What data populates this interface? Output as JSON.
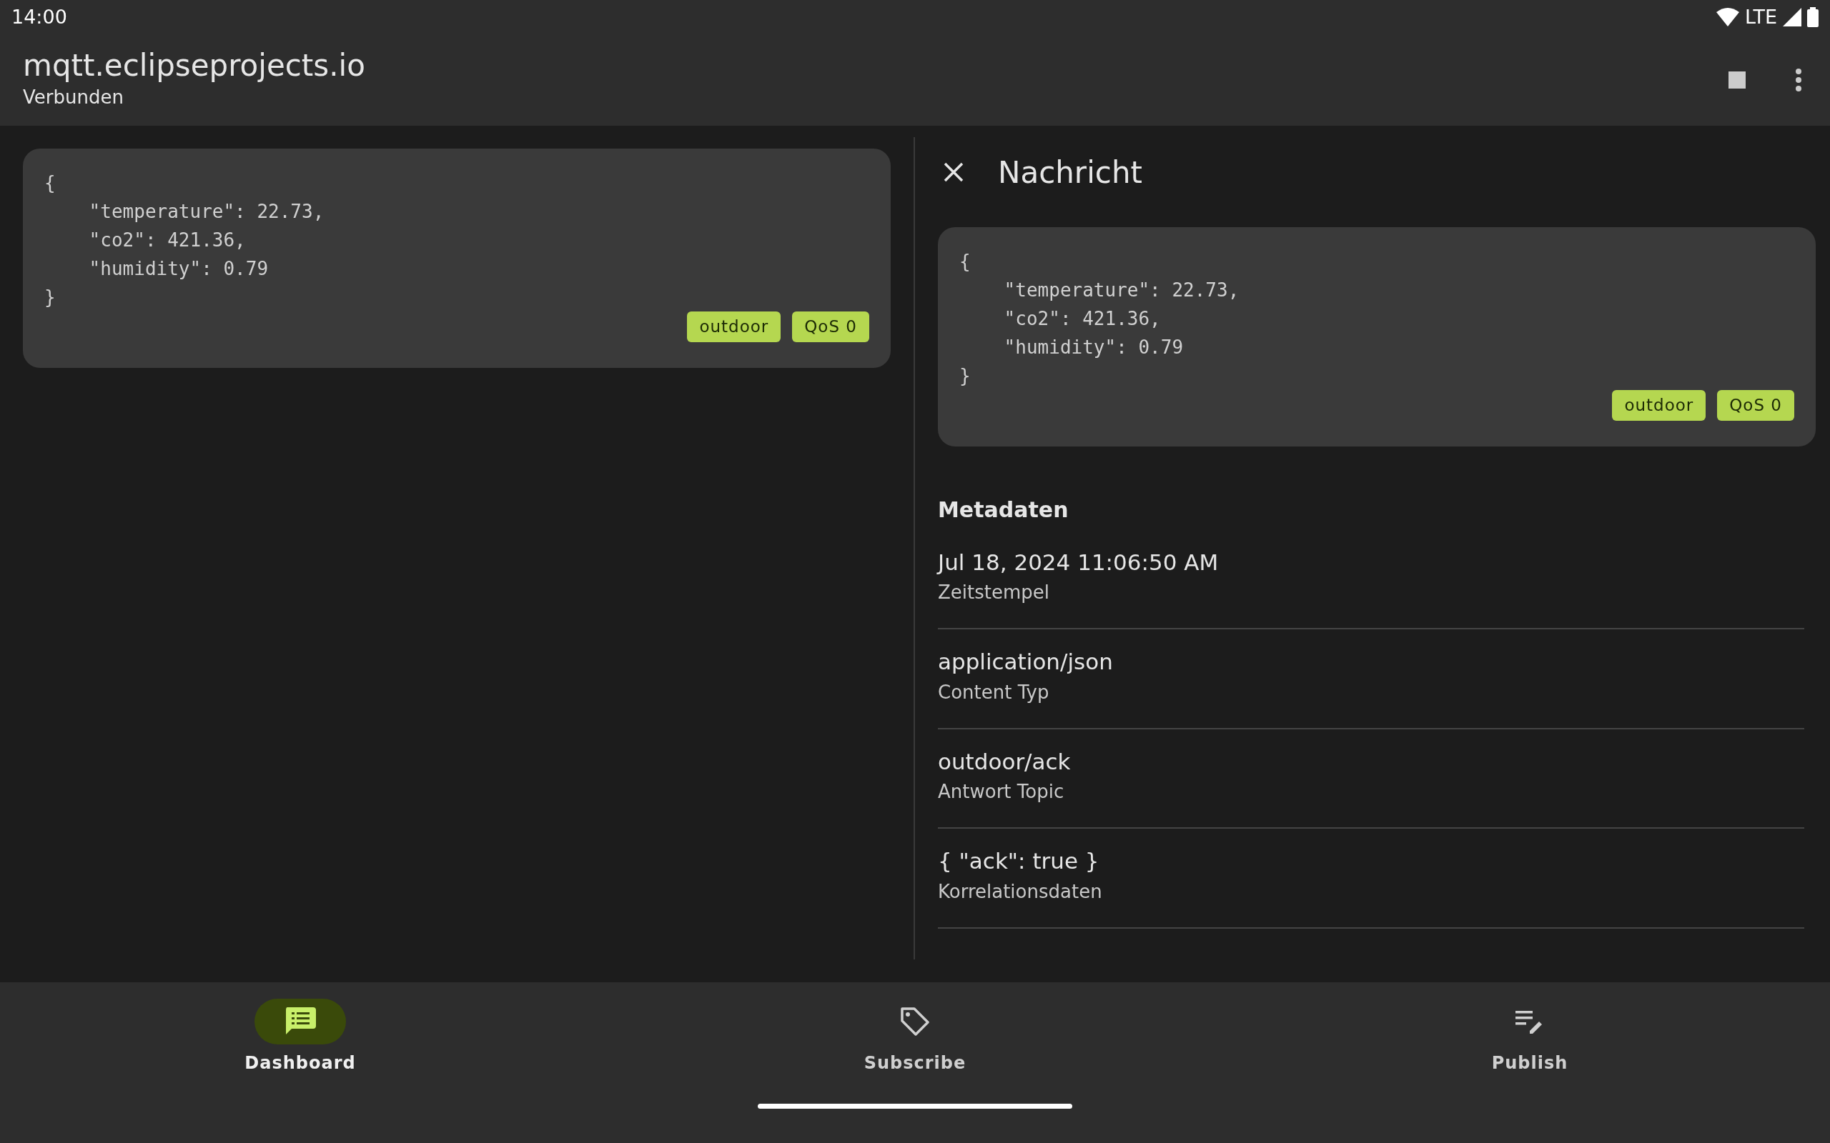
{
  "status_bar": {
    "time": "14:00",
    "network": "LTE"
  },
  "app_bar": {
    "title": "mqtt.eclipseprojects.io",
    "subtitle": "Verbunden"
  },
  "messages": [
    {
      "payload": "{\n    \"temperature\": 22.73,\n    \"co2\": 421.36,\n    \"humidity\": 0.79\n}",
      "tags": [
        "outdoor",
        "QoS 0"
      ]
    }
  ],
  "detail": {
    "title": "Nachricht",
    "payload": "{\n    \"temperature\": 22.73,\n    \"co2\": 421.36,\n    \"humidity\": 0.79\n}",
    "tags": [
      "outdoor",
      "QoS 0"
    ],
    "metadata_title": "Metadaten",
    "metadata": [
      {
        "value": "Jul 18, 2024 11:06:50 AM",
        "label": "Zeitstempel"
      },
      {
        "value": "application/json",
        "label": "Content Typ"
      },
      {
        "value": "outdoor/ack",
        "label": "Antwort Topic"
      },
      {
        "value": "{ \"ack\": true }",
        "label": "Korrelationsdaten"
      }
    ]
  },
  "nav": [
    {
      "kind": "dashboard",
      "label": "Dashboard",
      "selected": true
    },
    {
      "kind": "subscribe",
      "label": "Subscribe",
      "selected": false
    },
    {
      "kind": "publish",
      "label": "Publish",
      "selected": false
    }
  ]
}
